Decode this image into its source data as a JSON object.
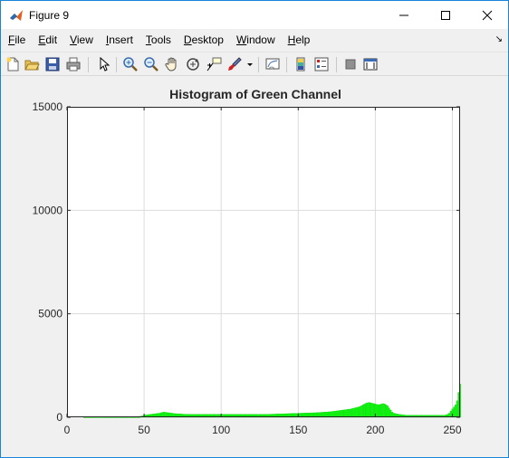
{
  "window": {
    "title": "Figure 9"
  },
  "menu": {
    "items": [
      {
        "underline": "F",
        "rest": "ile"
      },
      {
        "underline": "E",
        "rest": "dit"
      },
      {
        "underline": "V",
        "rest": "iew"
      },
      {
        "underline": "I",
        "rest": "nsert"
      },
      {
        "underline": "T",
        "rest": "ools"
      },
      {
        "underline": "D",
        "rest": "esktop"
      },
      {
        "underline": "W",
        "rest": "indow"
      },
      {
        "underline": "H",
        "rest": "elp"
      }
    ]
  },
  "toolbar": {
    "icons": [
      "new-figure-icon",
      "open-file-icon",
      "save-icon",
      "print-icon",
      "edit-plot-arrow-icon",
      "zoom-in-icon",
      "zoom-out-icon",
      "pan-hand-icon",
      "rotate-3d-icon",
      "data-cursor-icon",
      "brush-icon",
      "brush-dropdown-icon",
      "link-plot-icon",
      "colorbar-icon",
      "legend-icon",
      "hide-plot-tools-icon",
      "show-plot-tools-icon"
    ]
  },
  "colors": {
    "bar": "#00ff00",
    "bar_edge": "#00c800",
    "grid": "#dcdcdc",
    "axes_bg": "#ffffff"
  },
  "chart_data": {
    "type": "bar",
    "title": "Histogram of Green Channel",
    "xlabel": "",
    "ylabel": "",
    "xlim": [
      0,
      255
    ],
    "ylim": [
      0,
      15000
    ],
    "xticks": [
      0,
      50,
      100,
      150,
      200,
      250
    ],
    "yticks": [
      0,
      5000,
      10000,
      15000
    ],
    "grid": true,
    "series": [
      {
        "values": [
          0,
          0,
          0,
          0,
          0,
          0,
          0,
          0,
          0,
          0,
          0,
          15,
          15,
          15,
          15,
          15,
          15,
          15,
          15,
          15,
          15,
          15,
          15,
          15,
          15,
          15,
          15,
          15,
          15,
          15,
          15,
          15,
          15,
          15,
          15,
          15,
          15,
          15,
          15,
          15,
          15,
          15,
          15,
          15,
          15,
          15,
          15,
          15,
          50,
          70,
          100,
          110,
          120,
          130,
          140,
          150,
          160,
          170,
          180,
          190,
          200,
          220,
          240,
          250,
          240,
          230,
          220,
          210,
          200,
          190,
          180,
          175,
          170,
          165,
          160,
          155,
          150,
          148,
          146,
          144,
          142,
          140,
          140,
          140,
          140,
          140,
          140,
          140,
          140,
          140,
          140,
          140,
          140,
          140,
          140,
          140,
          140,
          140,
          140,
          140,
          140,
          140,
          140,
          140,
          140,
          140,
          140,
          140,
          140,
          140,
          140,
          140,
          140,
          140,
          140,
          140,
          140,
          140,
          140,
          140,
          140,
          140,
          140,
          140,
          140,
          140,
          140,
          140,
          140,
          140,
          145,
          145,
          150,
          150,
          155,
          155,
          160,
          160,
          165,
          165,
          170,
          170,
          175,
          175,
          180,
          180,
          185,
          185,
          190,
          190,
          195,
          195,
          200,
          200,
          205,
          205,
          210,
          210,
          215,
          215,
          220,
          220,
          225,
          230,
          235,
          240,
          245,
          250,
          255,
          260,
          265,
          270,
          280,
          290,
          300,
          310,
          320,
          330,
          340,
          350,
          360,
          370,
          380,
          390,
          400,
          420,
          440,
          460,
          480,
          500,
          520,
          560,
          600,
          640,
          680,
          700,
          720,
          700,
          680,
          660,
          640,
          620,
          600,
          620,
          640,
          660,
          650,
          600,
          550,
          450,
          350,
          250,
          200,
          180,
          160,
          150,
          140,
          130,
          120,
          110,
          100,
          100,
          100,
          100,
          100,
          100,
          100,
          100,
          100,
          100,
          100,
          100,
          100,
          100,
          100,
          100,
          100,
          100,
          100,
          100,
          100,
          100,
          100,
          100,
          100,
          100,
          120,
          150,
          200,
          300,
          400,
          500,
          600,
          800,
          1200,
          1600
        ]
      }
    ]
  }
}
